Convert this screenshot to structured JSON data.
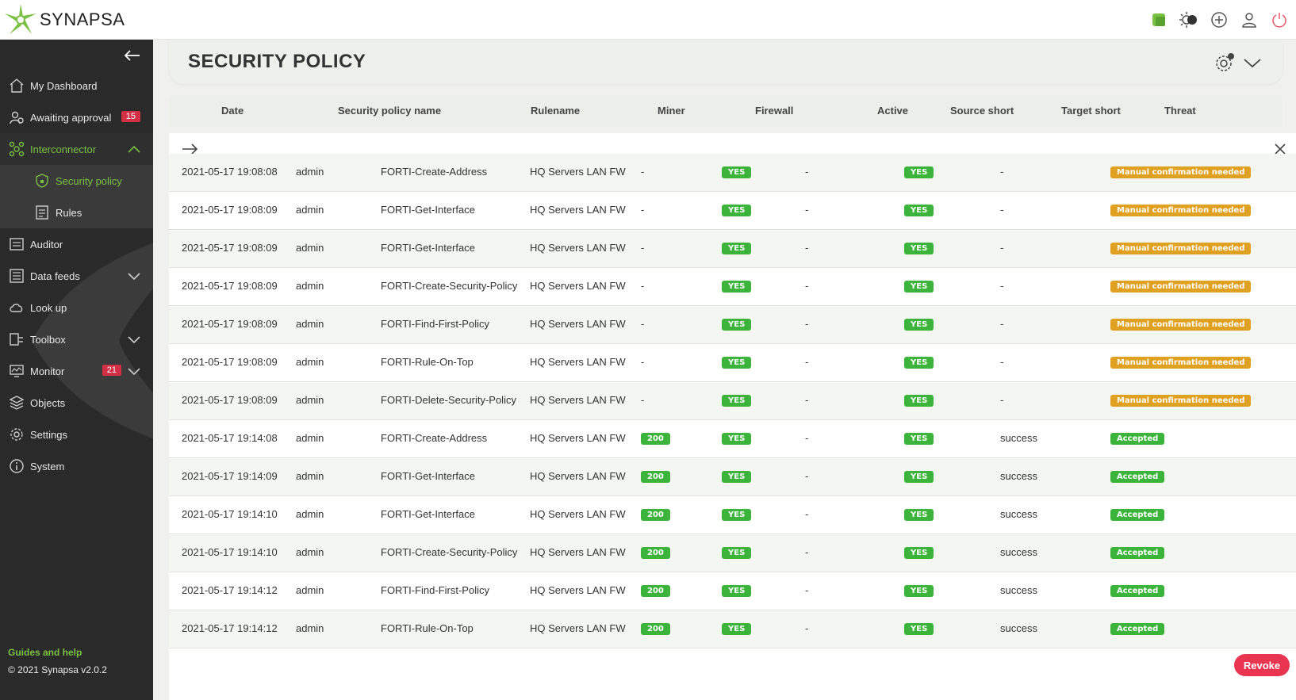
{
  "app": {
    "brand": "SYNAPSA"
  },
  "page": {
    "title": "SECURITY POLICY"
  },
  "sidebar": {
    "items": [
      {
        "label": "My Dashboard",
        "icon": "home-icon"
      },
      {
        "label": "Awaiting approval",
        "icon": "approval-icon",
        "badge": "15"
      },
      {
        "label": "Interconnector",
        "icon": "interconnector-icon",
        "active": true
      },
      {
        "label": "Security policy",
        "icon": "shield-icon",
        "sub": true,
        "current": true
      },
      {
        "label": "Rules",
        "icon": "rules-icon",
        "sub": true
      },
      {
        "label": "Auditor",
        "icon": "auditor-icon"
      },
      {
        "label": "Data feeds",
        "icon": "data-feeds-icon"
      },
      {
        "label": "Look up",
        "icon": "cloud-icon"
      },
      {
        "label": "Toolbox",
        "icon": "toolbox-icon"
      },
      {
        "label": "Monitor",
        "icon": "monitor-icon",
        "badge": "21"
      },
      {
        "label": "Objects",
        "icon": "layers-icon"
      },
      {
        "label": "Settings",
        "icon": "gear-icon"
      },
      {
        "label": "System",
        "icon": "info-icon"
      }
    ],
    "guides": "Guides and help",
    "copyright": "© 2021 Synapsa v2.0.2"
  },
  "table": {
    "headers": [
      "Date",
      "Security policy name",
      "Rulename",
      "Miner",
      "Firewall",
      "Active",
      "Source short",
      "Target short",
      "Threat"
    ],
    "rows": [
      [
        "2021-05-17 19:08:08",
        "admin",
        "FORTI-Create-Address",
        "HQ Servers LAN FW",
        "-",
        "YES",
        "-",
        "YES",
        "-",
        "Manual confirmation needed"
      ],
      [
        "2021-05-17 19:08:09",
        "admin",
        "FORTI-Get-Interface",
        "HQ Servers LAN FW",
        "-",
        "YES",
        "-",
        "YES",
        "-",
        "Manual confirmation needed"
      ],
      [
        "2021-05-17 19:08:09",
        "admin",
        "FORTI-Get-Interface",
        "HQ Servers LAN FW",
        "-",
        "YES",
        "-",
        "YES",
        "-",
        "Manual confirmation needed"
      ],
      [
        "2021-05-17 19:08:09",
        "admin",
        "FORTI-Create-Security-Policy",
        "HQ Servers LAN FW",
        "-",
        "YES",
        "-",
        "YES",
        "-",
        "Manual confirmation needed"
      ],
      [
        "2021-05-17 19:08:09",
        "admin",
        "FORTI-Find-First-Policy",
        "HQ Servers LAN FW",
        "-",
        "YES",
        "-",
        "YES",
        "-",
        "Manual confirmation needed"
      ],
      [
        "2021-05-17 19:08:09",
        "admin",
        "FORTI-Rule-On-Top",
        "HQ Servers LAN FW",
        "-",
        "YES",
        "-",
        "YES",
        "-",
        "Manual confirmation needed"
      ],
      [
        "2021-05-17 19:08:09",
        "admin",
        "FORTI-Delete-Security-Policy",
        "HQ Servers LAN FW",
        "-",
        "YES",
        "-",
        "YES",
        "-",
        "Manual confirmation needed"
      ],
      [
        "2021-05-17 19:14:08",
        "admin",
        "FORTI-Create-Address",
        "HQ Servers LAN FW",
        "200",
        "YES",
        "-",
        "YES",
        "success",
        "Accepted"
      ],
      [
        "2021-05-17 19:14:09",
        "admin",
        "FORTI-Get-Interface",
        "HQ Servers LAN FW",
        "200",
        "YES",
        "-",
        "YES",
        "success",
        "Accepted"
      ],
      [
        "2021-05-17 19:14:10",
        "admin",
        "FORTI-Get-Interface",
        "HQ Servers LAN FW",
        "200",
        "YES",
        "-",
        "YES",
        "success",
        "Accepted"
      ],
      [
        "2021-05-17 19:14:10",
        "admin",
        "FORTI-Create-Security-Policy",
        "HQ Servers LAN FW",
        "200",
        "YES",
        "-",
        "YES",
        "success",
        "Accepted"
      ],
      [
        "2021-05-17 19:14:12",
        "admin",
        "FORTI-Find-First-Policy",
        "HQ Servers LAN FW",
        "200",
        "YES",
        "-",
        "YES",
        "success",
        "Accepted"
      ],
      [
        "2021-05-17 19:14:12",
        "admin",
        "FORTI-Rule-On-Top",
        "HQ Servers LAN FW",
        "200",
        "YES",
        "-",
        "YES",
        "success",
        "Accepted"
      ]
    ]
  },
  "actions": {
    "revoke": "Revoke"
  },
  "colors": {
    "accent": "#7ac143",
    "badge": "#d32f45",
    "pill_green": "#3cb43c",
    "pill_orange": "#e0a020",
    "revoke": "#ea3550"
  }
}
